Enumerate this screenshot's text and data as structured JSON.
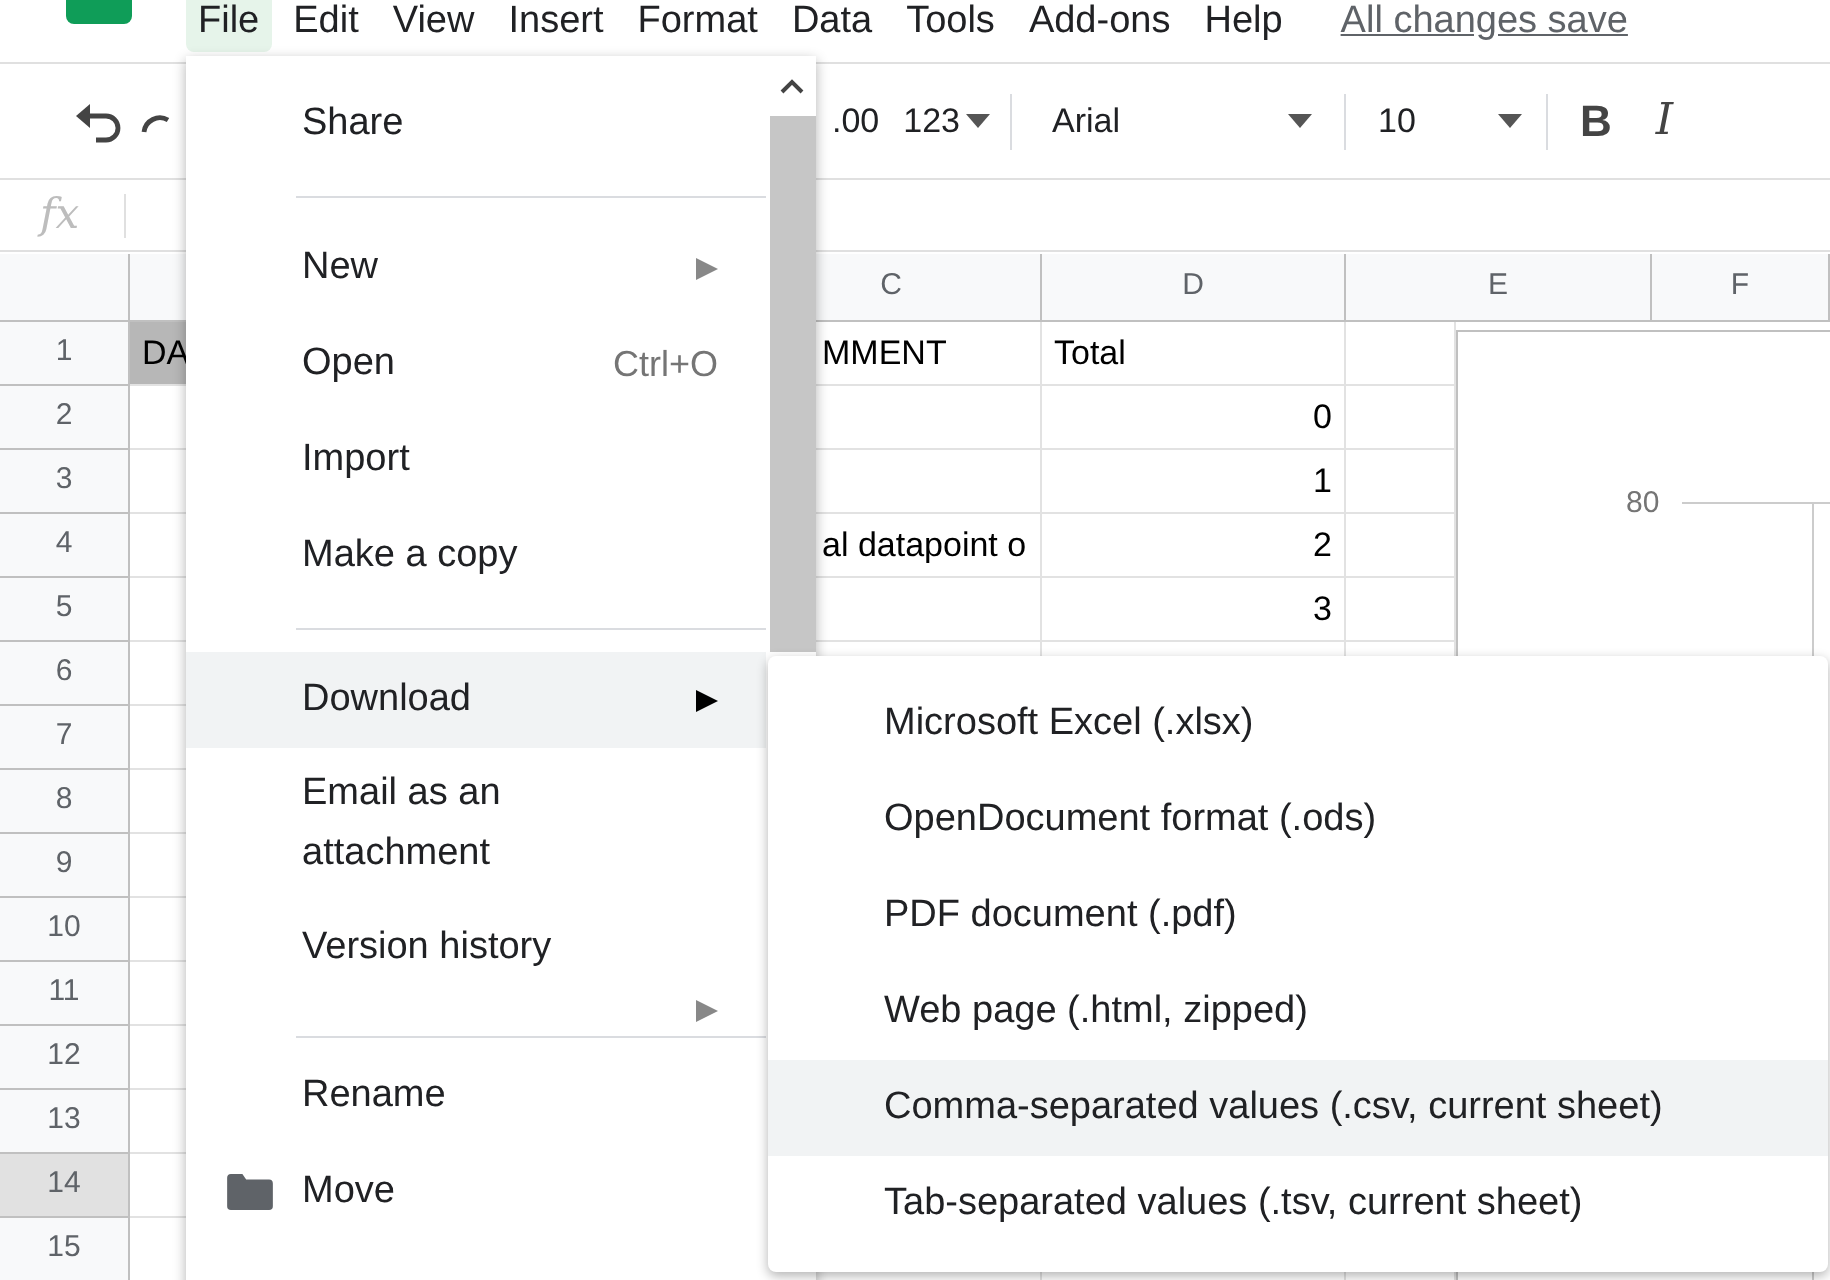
{
  "menu_bar": {
    "items": [
      {
        "label": "File",
        "selected": true
      },
      {
        "label": "Edit",
        "selected": false
      },
      {
        "label": "View",
        "selected": false
      },
      {
        "label": "Insert",
        "selected": false
      },
      {
        "label": "Format",
        "selected": false
      },
      {
        "label": "Data",
        "selected": false
      },
      {
        "label": "Tools",
        "selected": false
      },
      {
        "label": "Add-ons",
        "selected": false
      },
      {
        "label": "Help",
        "selected": false
      }
    ],
    "save_status": "All changes save"
  },
  "toolbar": {
    "decimal_increase": ".00",
    "number_format": "123",
    "font": "Arial",
    "font_size": "10",
    "bold": "B",
    "italic": "I"
  },
  "formula_bar": {
    "label": "fx"
  },
  "sheet": {
    "columns": [
      "C",
      "D",
      "E",
      "F"
    ],
    "rows": [
      {
        "header": "1",
        "selected": false,
        "cells": {
          "column_a": {
            "text": "DA",
            "shaded": true,
            "kind": "text"
          },
          "column_c": {
            "text": "MMENT",
            "shaded": false,
            "kind": "text"
          },
          "column_d": {
            "text": "Total",
            "shaded": false,
            "kind": "text"
          }
        }
      },
      {
        "header": "2",
        "selected": false,
        "cells": {
          "column_d": {
            "text": "0",
            "shaded": false,
            "kind": "number"
          }
        }
      },
      {
        "header": "3",
        "selected": false,
        "cells": {
          "column_d": {
            "text": "1",
            "shaded": false,
            "kind": "number"
          }
        }
      },
      {
        "header": "4",
        "selected": false,
        "cells": {
          "column_c": {
            "text": "al datapoint o",
            "shaded": false,
            "kind": "text"
          },
          "column_d": {
            "text": "2",
            "shaded": false,
            "kind": "number"
          }
        }
      },
      {
        "header": "5",
        "selected": false,
        "cells": {
          "column_d": {
            "text": "3",
            "shaded": false,
            "kind": "number"
          }
        }
      },
      {
        "header": "6",
        "selected": false,
        "cells": {}
      },
      {
        "header": "7",
        "selected": false,
        "cells": {}
      },
      {
        "header": "8",
        "selected": false,
        "cells": {}
      },
      {
        "header": "9",
        "selected": false,
        "cells": {}
      },
      {
        "header": "10",
        "selected": false,
        "cells": {}
      },
      {
        "header": "11",
        "selected": false,
        "cells": {}
      },
      {
        "header": "12",
        "selected": false,
        "cells": {}
      },
      {
        "header": "13",
        "selected": false,
        "cells": {}
      },
      {
        "header": "14",
        "selected": true,
        "cells": {}
      },
      {
        "header": "15",
        "selected": false,
        "cells": {}
      }
    ],
    "chart": {
      "axis_label": "80"
    }
  },
  "file_menu": {
    "items": [
      {
        "kind": "item",
        "label": "Share",
        "selected": false,
        "submenu": false
      },
      {
        "kind": "divider"
      },
      {
        "kind": "item",
        "label": "New",
        "selected": false,
        "submenu": true
      },
      {
        "kind": "item",
        "label": "Open",
        "shortcut": "Ctrl+O",
        "selected": false,
        "submenu": false
      },
      {
        "kind": "item",
        "label": "Import",
        "selected": false,
        "submenu": false
      },
      {
        "kind": "item",
        "label": "Make a copy",
        "selected": false,
        "submenu": false
      },
      {
        "kind": "divider"
      },
      {
        "kind": "item",
        "label": "Download",
        "selected": true,
        "submenu": true
      },
      {
        "kind": "item",
        "label": "Email as an attachment",
        "selected": false,
        "submenu": false
      },
      {
        "kind": "item",
        "label": "Version history",
        "selected": false,
        "submenu": false
      },
      {
        "kind": "arrow_only",
        "submenu": true
      },
      {
        "kind": "divider"
      },
      {
        "kind": "item",
        "label": "Rename",
        "selected": false,
        "submenu": false
      },
      {
        "kind": "icon_item",
        "label": "Move",
        "selected": false,
        "submenu": false
      }
    ]
  },
  "download_submenu": {
    "items": [
      {
        "label": "Microsoft Excel (.xlsx)",
        "selected": false
      },
      {
        "label": "OpenDocument format (.ods)",
        "selected": false
      },
      {
        "label": "PDF document (.pdf)",
        "selected": false
      },
      {
        "label": "Web page (.html, zipped)",
        "selected": false
      },
      {
        "label": "Comma-separated values (.csv, current sheet)",
        "selected": true
      },
      {
        "label": "Tab-separated values (.tsv, current sheet)",
        "selected": false
      }
    ]
  }
}
